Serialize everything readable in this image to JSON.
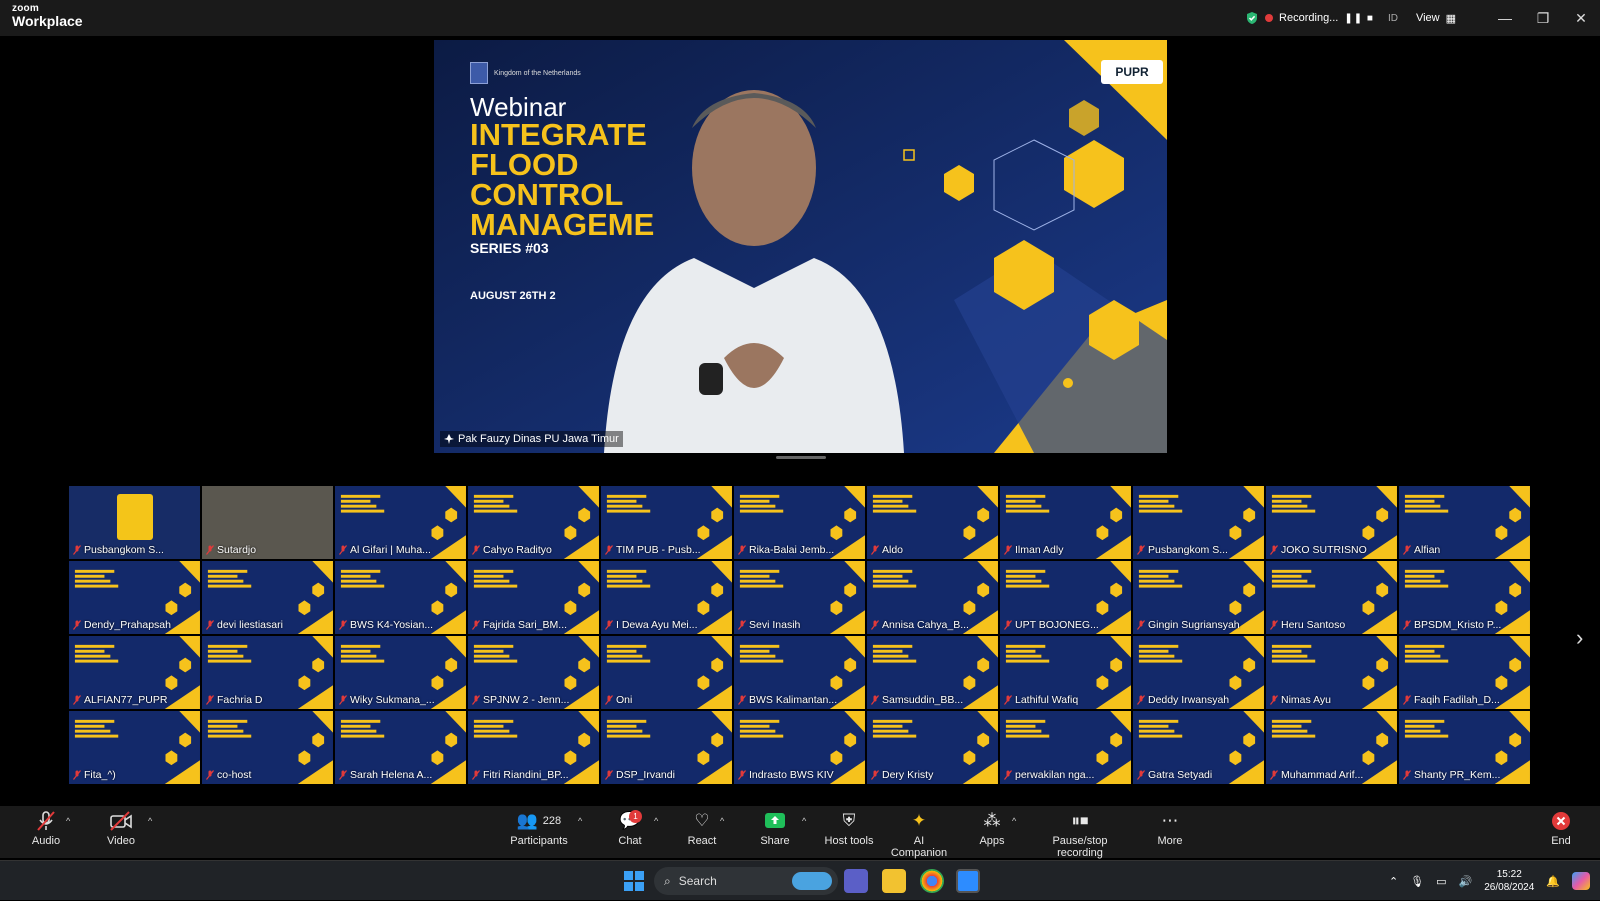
{
  "titlebar": {
    "brand_top": "zoom",
    "brand_bottom": "Workplace",
    "recording_label": "Recording...",
    "recording_controls": "❚❚ ■",
    "id_label": "ID",
    "view_label": "View"
  },
  "stage": {
    "kingdom": "Kingdom of the Netherlands",
    "webinar_word": "Webinar",
    "title_lines": [
      "INTEGRATE",
      "FLOOD",
      "CONTROL",
      "MANAGEME"
    ],
    "series": "SERIES #03",
    "date": "AUGUST 26TH  2",
    "logo": "PUPR",
    "speaker_name": "Pak Fauzy Dinas PU Jawa Timur"
  },
  "participants": [
    "Pusbangkom S...",
    "Sutardjo",
    "Al Gifari | Muha...",
    "Cahyo Radityo",
    "TIM PUB - Pusb...",
    "Rika-Balai Jemb...",
    "Aldo",
    "Ilman Adly",
    "Pusbangkom S...",
    "JOKO SUTRISNO",
    "Alfian",
    "Dendy_Prahapsah",
    "devi liestiasari",
    "BWS K4-Yosian...",
    "Fajrida Sari_BM...",
    "I Dewa Ayu Mei...",
    "Sevi Inasih",
    "Annisa Cahya_B...",
    "UPT BOJONEG...",
    "Gingin Sugriansyah",
    "Heru Santoso",
    "BPSDM_Kristo P...",
    "ALFIAN77_PUPR",
    "Fachria D",
    "Wiky Sukmana_...",
    "SPJNW 2 - Jenn...",
    "Oni",
    "BWS Kalimantan...",
    "Samsuddin_BB...",
    "Lathiful Wafiq",
    "Deddy Irwansyah",
    "Nimas Ayu",
    "Faqih Fadilah_D...",
    "Fita_^)",
    "co-host",
    "Sarah Helena A...",
    "Fitri Riandini_BP...",
    "DSP_Irvandi",
    "Indrasto BWS KIV",
    "Dery Kristy",
    "perwakilan nga...",
    "Gatra Setyadi",
    "Muhammad Arif...",
    "Shanty PR_Kem..."
  ],
  "toolbar": {
    "audio": "Audio",
    "video": "Video",
    "participants_count": "228",
    "participants": "Participants",
    "chat": "Chat",
    "chat_badge": "1",
    "react": "React",
    "share": "Share",
    "host_tools": "Host tools",
    "ai_companion": "AI Companion",
    "apps": "Apps",
    "pause_stop": "Pause/stop recording",
    "more": "More",
    "end": "End"
  },
  "taskbar": {
    "search_placeholder": "Search",
    "time": "15:22",
    "date": "26/08/2024"
  },
  "colors": {
    "accent_yellow": "#f6c21c",
    "navy": "#0f2150",
    "end_red": "#e23a3a",
    "share_green": "#1fbf5a"
  }
}
